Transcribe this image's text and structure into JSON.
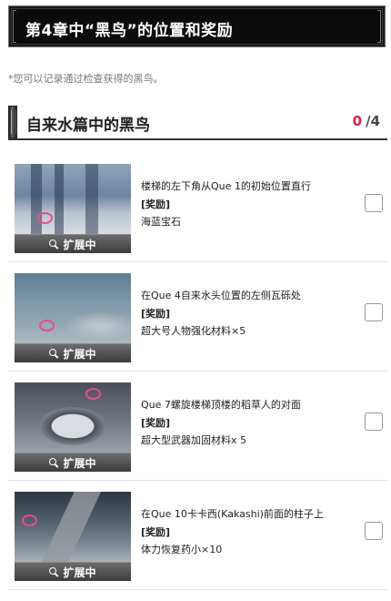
{
  "title": "第4章中“黑鸟”的位置和奖励",
  "note": "*您可以记录通过检查获得的黑鸟。",
  "section": {
    "title": "自来水篇中的黑鸟",
    "count_current": "0",
    "count_sep": "/",
    "count_total": "4"
  },
  "items": [
    {
      "location": "楼梯的左下角从Que 1的初始位置直行",
      "reward_label": "[奖励]",
      "reward": "海蓝宝石",
      "expand_label": "扩展中",
      "checked": false
    },
    {
      "location": "在Que 4自来水头位置的左侧瓦砾处",
      "reward_label": "[奖励]",
      "reward": "超大号人物强化材料×5",
      "expand_label": "扩展中",
      "checked": false
    },
    {
      "location": "Que 7螺旋楼梯顶楼的稻草人的对面",
      "reward_label": "[奖励]",
      "reward": "超大型武器加固材料x 5",
      "expand_label": "扩展中",
      "checked": false
    },
    {
      "location": "在Que 10卡卡西(Kakashi)前面的柱子上",
      "reward_label": "[奖励]",
      "reward": "体力恢复药小×10",
      "expand_label": "扩展中",
      "checked": false
    }
  ],
  "colors": {
    "accent": "#d3254a",
    "marker": "#e0508c",
    "title_bg": "#0b0b0b"
  },
  "icons": {
    "expand": "zoom-in-icon",
    "marker": "location-marker-icon"
  }
}
